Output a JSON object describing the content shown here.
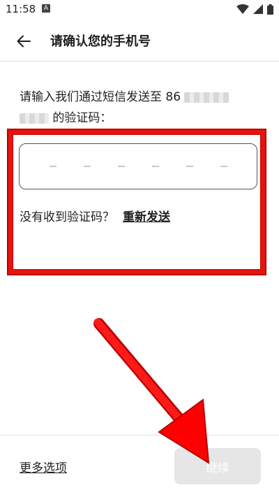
{
  "status_bar": {
    "time": "11:58",
    "notification_icon": "A"
  },
  "header": {
    "back_icon": "arrow-left",
    "title": "请确认您的手机号"
  },
  "instruction": {
    "prefix": "请输入我们通过短信发送至 86",
    "suffix": "的验证码："
  },
  "code_input": {
    "slots": 6,
    "value": ""
  },
  "resend": {
    "question": "没有收到验证码？",
    "link_label": "重新发送"
  },
  "footer": {
    "more_options_label": "更多选项",
    "continue_label": "继续"
  },
  "annotation": {
    "highlight_color": "#e8130f",
    "arrow_color": "#ff0000"
  }
}
